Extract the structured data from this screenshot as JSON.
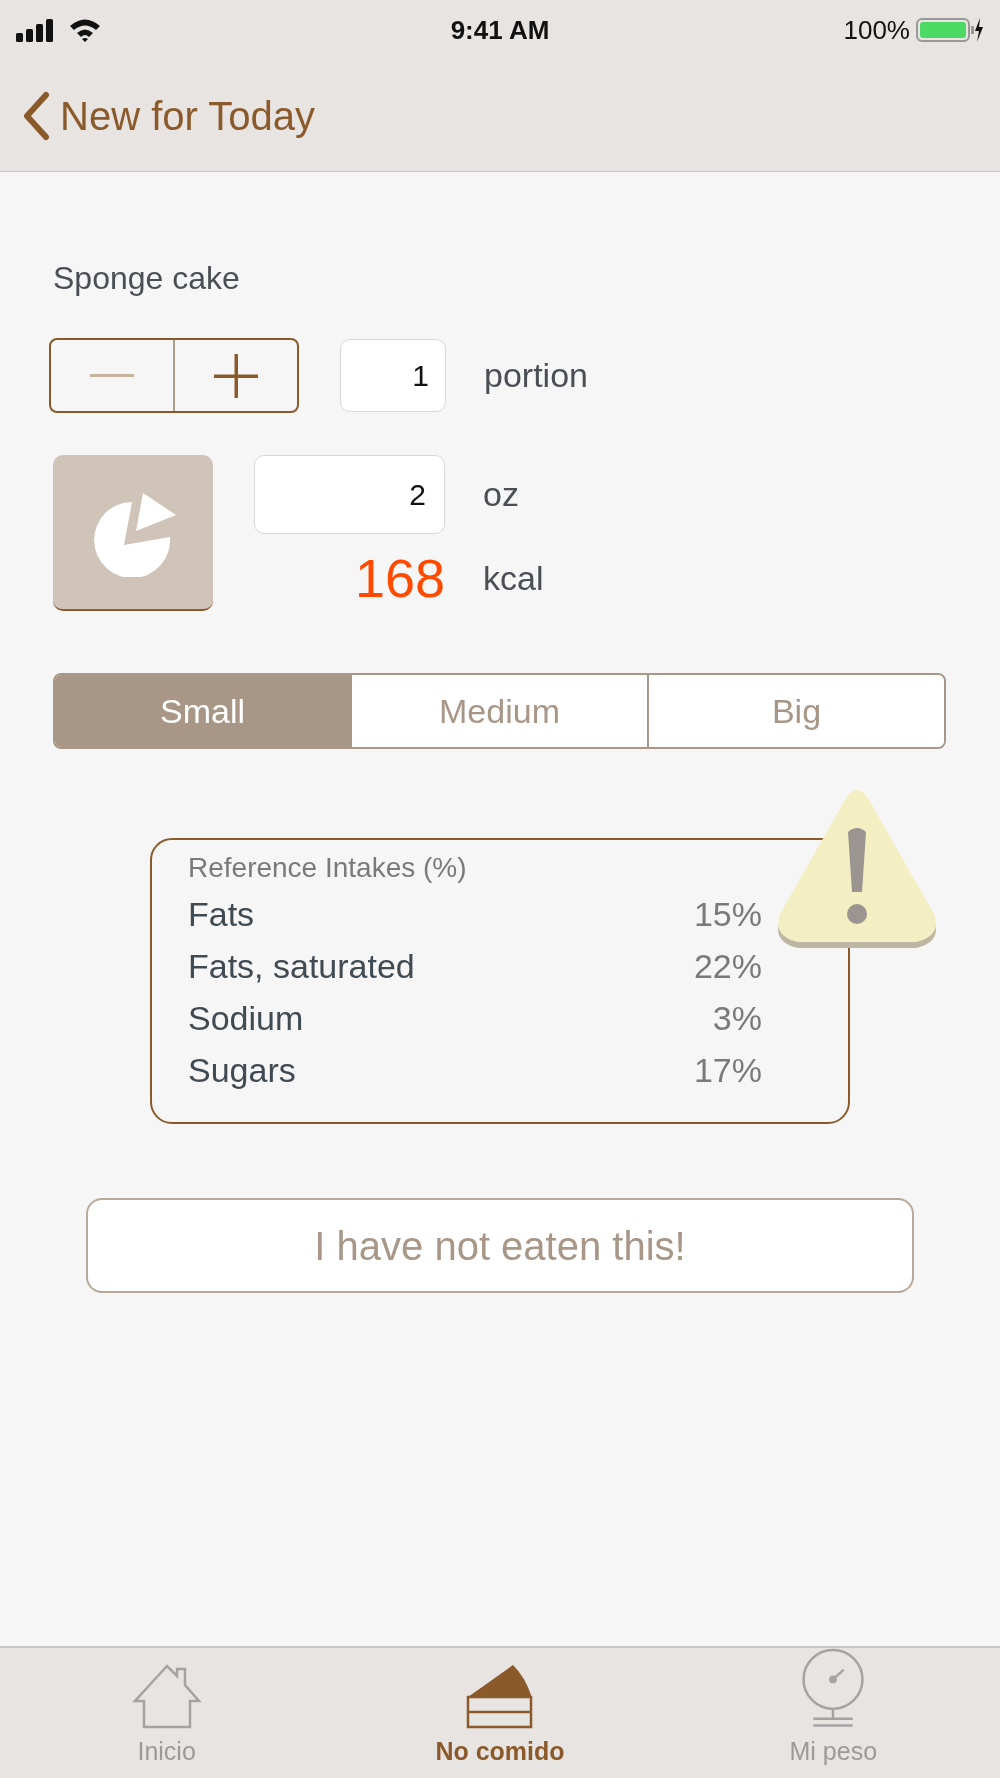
{
  "status_bar": {
    "time": "9:41 AM",
    "battery": "100%"
  },
  "nav": {
    "back_label": "New for Today"
  },
  "food": {
    "name": "Sponge cake"
  },
  "portion": {
    "value": "1",
    "unit": "portion"
  },
  "weight": {
    "value": "2",
    "unit": "oz"
  },
  "energy": {
    "value": "168",
    "unit": "kcal"
  },
  "sizes": [
    {
      "label": "Small",
      "selected": true
    },
    {
      "label": "Medium",
      "selected": false
    },
    {
      "label": "Big",
      "selected": false
    }
  ],
  "reference_intakes": {
    "title": "Reference Intakes (%)",
    "warning": true,
    "rows": [
      {
        "name": "Fats",
        "value": "15%"
      },
      {
        "name": "Fats, saturated",
        "value": "22%"
      },
      {
        "name": "Sodium",
        "value": "3%"
      },
      {
        "name": "Sugars",
        "value": "17%"
      }
    ]
  },
  "action_button": "I have not eaten this!",
  "tab_bar": [
    {
      "kind": "home",
      "label": "Inicio",
      "selected": false
    },
    {
      "kind": "cake",
      "label": "No comido",
      "selected": true
    },
    {
      "kind": "scale",
      "label": "Mi peso",
      "selected": false
    }
  ]
}
